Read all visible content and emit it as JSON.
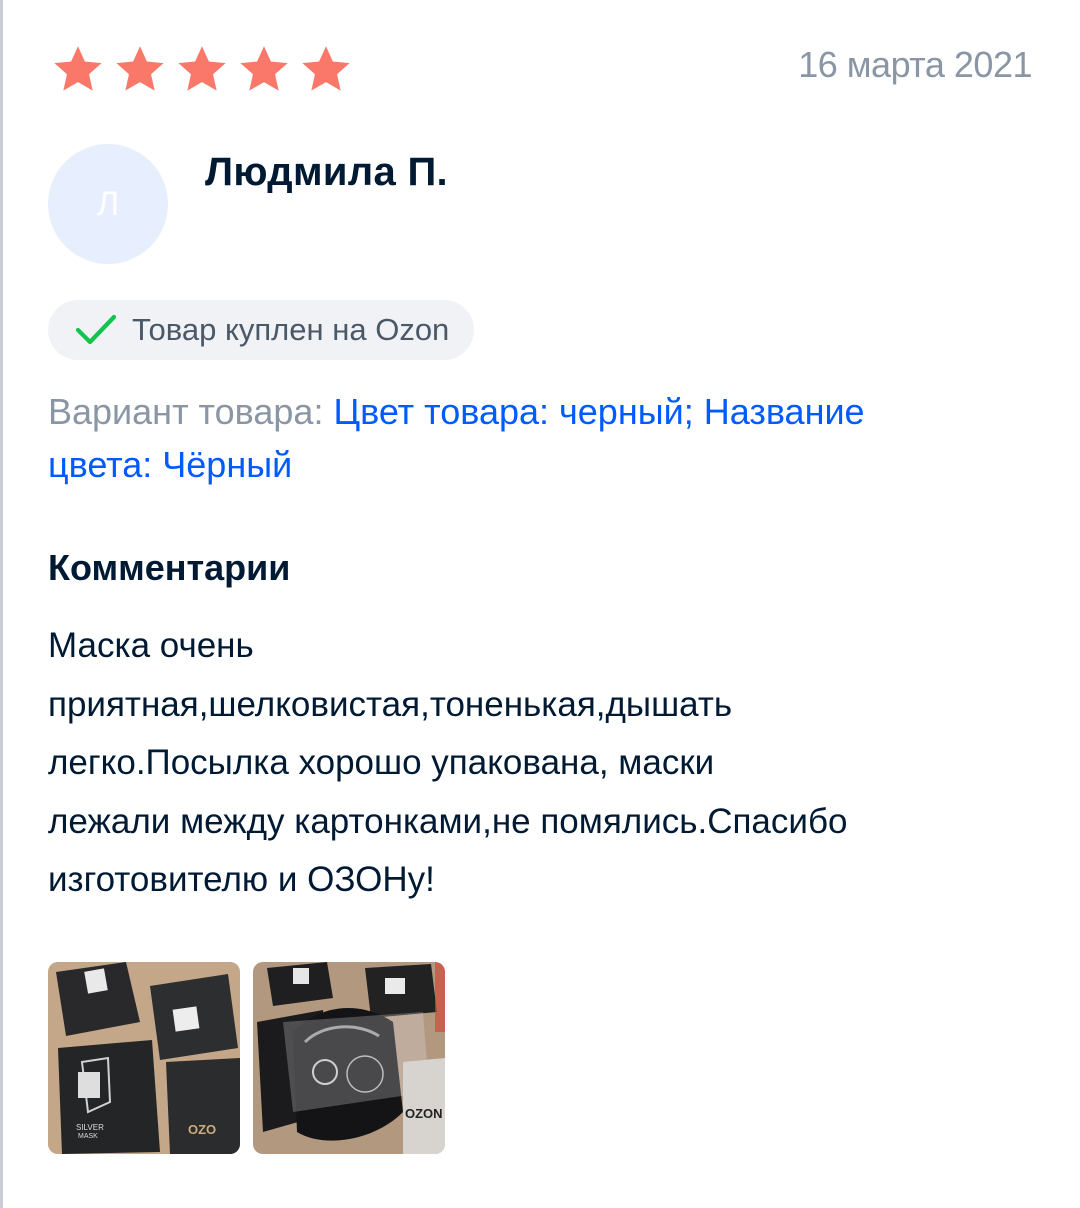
{
  "review": {
    "rating": 5,
    "rating_max": 5,
    "date": "16 марта 2021",
    "author": {
      "name": "Людмила П.",
      "avatar_initial": "Л"
    },
    "verified_badge": "Товар куплен на Ozon",
    "variant": {
      "label": "Вариант товара:",
      "value_line1": "Цвет товара: черный; Название",
      "value_line2": "цвета: Чёрный"
    },
    "comments_heading": "Комментарии",
    "comment_lines": [
      "Маска очень",
      "приятная,шелковистая,тоненькая,дышать",
      "легко.Посылка хорошо упакована, маски",
      "лежали между картонками,не помялись.Спасибо",
      "изготовителю и ОЗОНу!"
    ],
    "photos": [
      {
        "alt": "photo-boxes",
        "texts": [
          "SILVER",
          "MASK",
          "OZO"
        ]
      },
      {
        "alt": "photo-mask",
        "texts": [
          "OZON"
        ]
      }
    ]
  },
  "colors": {
    "star": "#f9786a",
    "accent_blue": "#005bff",
    "check_green": "#10c44c",
    "muted_text": "#8a96a5",
    "dark_text": "#001a34",
    "avatar_bg": "#e7eefe",
    "badge_bg": "#f0f2f5"
  },
  "icons": {
    "star": "star-icon",
    "check": "check-icon"
  }
}
